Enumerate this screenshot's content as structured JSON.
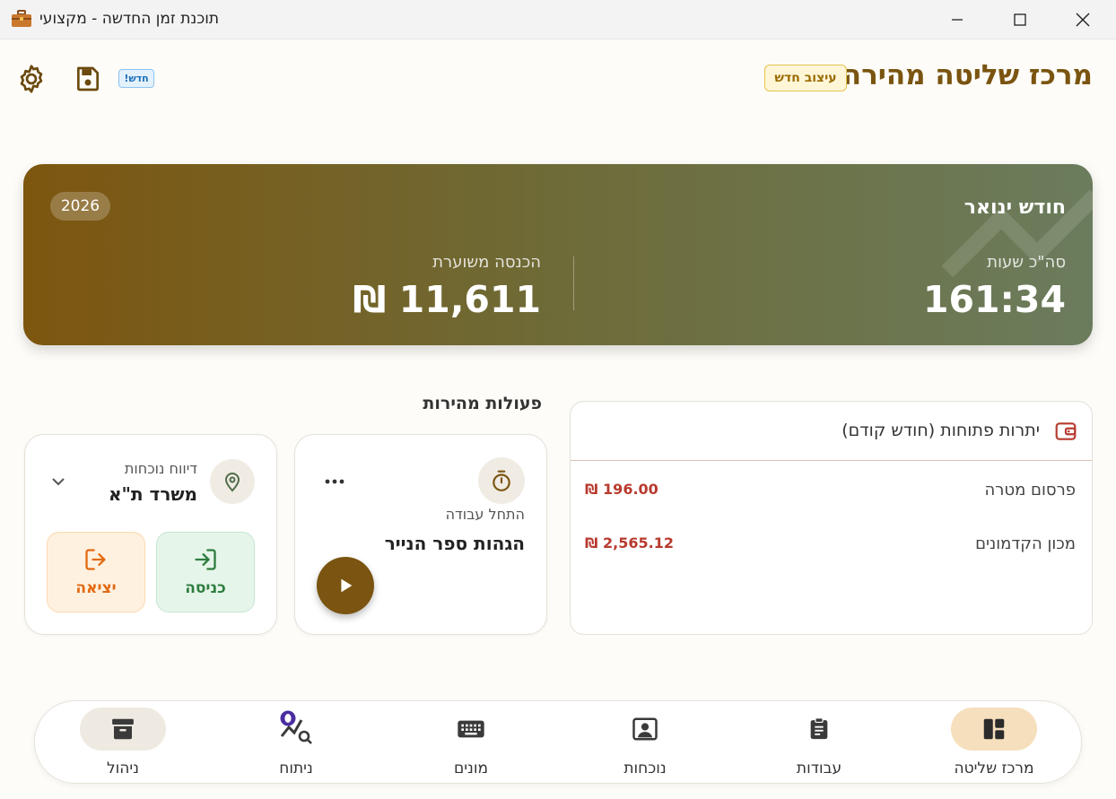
{
  "window": {
    "title": "תוכנת זמן החדשה - מקצועי"
  },
  "header": {
    "title": "מרכז שליטה מהירה",
    "redesign_badge": "עיצוב חדש",
    "new_badge": "חדש!"
  },
  "summary": {
    "month": "חודש ינואר",
    "year": "2026",
    "hours_label": "סה\"כ שעות",
    "hours_value": "161:34",
    "income_label": "הכנסה משוערת",
    "income_value": "11,611 ₪"
  },
  "balances": {
    "title": "יתרות פתוחות (חודש קודם)",
    "rows": [
      {
        "name": "פרסום מטרה",
        "amount": "196.00 ₪"
      },
      {
        "name": "מכון הקדמונים",
        "amount": "2,565.12 ₪"
      }
    ]
  },
  "quick_actions": {
    "title": "פעולות מהירות",
    "work": {
      "subtitle": "התחל עבודה",
      "job_name": "הגהות ספר הנייר"
    },
    "attendance": {
      "subtitle": "דיווח נוכחות",
      "location": "משרד ת\"א",
      "in_label": "כניסה",
      "out_label": "יציאה"
    }
  },
  "nav": [
    {
      "label": "מרכז שליטה",
      "icon": "dashboard-icon",
      "active": true
    },
    {
      "label": "עבודות",
      "icon": "clipboard-icon",
      "active": false
    },
    {
      "label": "נוכחות",
      "icon": "person-card-icon",
      "active": false
    },
    {
      "label": "מונים",
      "icon": "keyboard-icon",
      "active": false
    },
    {
      "label": "ניתוח",
      "icon": "analytics-icon",
      "active": false
    },
    {
      "label": "ניהול",
      "icon": "archive-icon",
      "active": false
    }
  ],
  "colors": {
    "brand": "#7a5410",
    "nav_active": "#f6dfbd",
    "amount": "#b83a2e",
    "checkin": "#2e7d3e",
    "checkout": "#e26a12"
  }
}
